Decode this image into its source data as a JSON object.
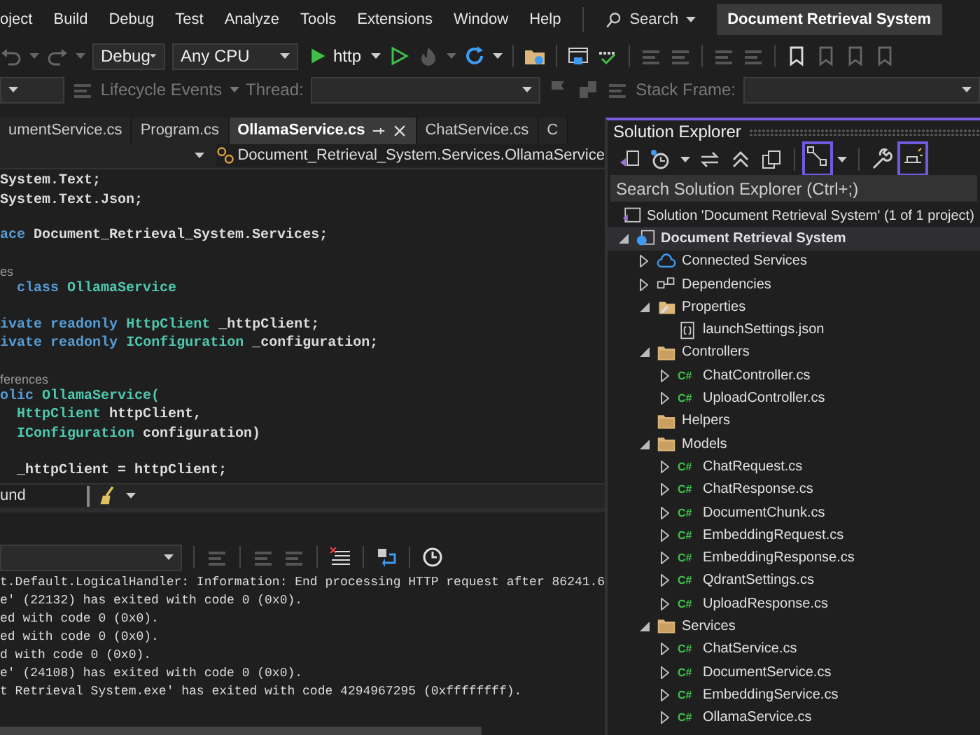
{
  "menu": [
    "oject",
    "Build",
    "Debug",
    "Test",
    "Analyze",
    "Tools",
    "Extensions",
    "Window",
    "Help"
  ],
  "search": {
    "label": "Search"
  },
  "solution_title": "Document Retrieval System",
  "toolbar": {
    "configuration": "Debug",
    "platform": "Any CPU",
    "run_target": "http"
  },
  "debug_location": {
    "lifecycle_events": "Lifecycle Events",
    "thread_label": "Thread:",
    "stack_frame_label": "Stack Frame:"
  },
  "editor": {
    "tabs": [
      {
        "label": "umentService.cs",
        "selected": false
      },
      {
        "label": "Program.cs",
        "selected": false
      },
      {
        "label": "OllamaService.cs",
        "selected": true
      },
      {
        "label": "ChatService.cs",
        "selected": false
      },
      {
        "label": "C",
        "selected": false
      }
    ],
    "navigation": "Document_Retrieval_System.Services.OllamaService",
    "lines": [
      {
        "kind": "code",
        "indent": false,
        "tokens": [
          {
            "text": "System.Text;",
            "kind": "plain"
          }
        ]
      },
      {
        "kind": "code",
        "indent": false,
        "tokens": [
          {
            "text": "System.Text.Json;",
            "kind": "plain"
          }
        ]
      },
      {
        "kind": "blank"
      },
      {
        "kind": "code",
        "indent": false,
        "tokens": [
          {
            "text": "ace",
            "kind": "keyword"
          },
          {
            "text": "Document_Retrieval_System.Services;",
            "kind": "plain"
          }
        ]
      },
      {
        "kind": "blank"
      },
      {
        "kind": "codelens",
        "indent": false,
        "tokens": [
          {
            "text": "es",
            "kind": "codelens"
          }
        ]
      },
      {
        "kind": "code",
        "indent": true,
        "tokens": [
          {
            "text": "class",
            "kind": "keyword"
          },
          {
            "text": "OllamaService",
            "kind": "type"
          }
        ]
      },
      {
        "kind": "blank"
      },
      {
        "kind": "code",
        "indent": false,
        "tokens": [
          {
            "text": "ivate",
            "kind": "keyword"
          },
          {
            "text": "readonly",
            "kind": "keyword"
          },
          {
            "text": "HttpClient",
            "kind": "type"
          },
          {
            "text": "_httpClient;",
            "kind": "plain"
          }
        ]
      },
      {
        "kind": "code",
        "indent": false,
        "tokens": [
          {
            "text": "ivate",
            "kind": "keyword"
          },
          {
            "text": "readonly",
            "kind": "keyword"
          },
          {
            "text": "IConfiguration",
            "kind": "type"
          },
          {
            "text": "_configuration;",
            "kind": "plain"
          }
        ]
      },
      {
        "kind": "blank"
      },
      {
        "kind": "codelens",
        "indent": false,
        "tokens": [
          {
            "text": "ferences",
            "kind": "codelens"
          }
        ]
      },
      {
        "kind": "code",
        "indent": false,
        "tokens": [
          {
            "text": "olic",
            "kind": "keyword"
          },
          {
            "text": "OllamaService(",
            "kind": "type"
          }
        ]
      },
      {
        "kind": "code",
        "indent": true,
        "tokens": [
          {
            "text": "HttpClient",
            "kind": "type"
          },
          {
            "text": "httpClient,",
            "kind": "plain"
          }
        ]
      },
      {
        "kind": "code",
        "indent": true,
        "tokens": [
          {
            "text": "IConfiguration",
            "kind": "type"
          },
          {
            "text": "configuration)",
            "kind": "plain"
          }
        ]
      },
      {
        "kind": "blank"
      },
      {
        "kind": "code",
        "indent": true,
        "tokens": [
          {
            "text": "_httpClient = httpClient;",
            "kind": "plain"
          }
        ]
      }
    ],
    "find": "und"
  },
  "output": {
    "lines": [
      "t.Default.LogicalHandler: Information: End processing HTTP request after 86241.6",
      "e' (22132) has exited with code 0 (0x0).",
      "ed with code 0 (0x0).",
      "ed with code 0 (0x0).",
      "d with code 0 (0x0).",
      "e' (24108) has exited with code 0 (0x0).",
      "t Retrieval System.exe' has exited with code 4294967295 (0xffffffff)."
    ]
  },
  "solution_explorer": {
    "title": "Solution Explorer",
    "search": {
      "placeholder": "Search Solution Explorer (Ctrl+;)"
    },
    "tree": [
      {
        "label": "Solution 'Document Retrieval System' (1 of 1 project)",
        "kind": "solution",
        "selected": false,
        "children": [
          {
            "label": "Document Retrieval System",
            "kind": "project",
            "selected": true,
            "expanded": true,
            "children": [
              {
                "label": "Connected Services",
                "kind": "connected",
                "selected": false,
                "expanded": false
              },
              {
                "label": "Dependencies",
                "kind": "dependencies",
                "selected": false,
                "expanded": false
              },
              {
                "label": "Properties",
                "kind": "properties",
                "selected": false,
                "expanded": true,
                "children": [
                  {
                    "label": "launchSettings.json",
                    "kind": "json",
                    "selected": false
                  }
                ]
              },
              {
                "label": "Controllers",
                "kind": "folder",
                "selected": false,
                "expanded": true,
                "children": [
                  {
                    "label": "ChatController.cs",
                    "kind": "csharp",
                    "icon_text": "C#",
                    "selected": false,
                    "expanded": false
                  },
                  {
                    "label": "UploadController.cs",
                    "kind": "csharp",
                    "icon_text": "C#",
                    "selected": false,
                    "expanded": false
                  }
                ]
              },
              {
                "label": "Helpers",
                "kind": "folder",
                "selected": false
              },
              {
                "label": "Models",
                "kind": "folder",
                "selected": false,
                "expanded": true,
                "children": [
                  {
                    "label": "ChatRequest.cs",
                    "kind": "csharp",
                    "icon_text": "C#",
                    "selected": false,
                    "expanded": false
                  },
                  {
                    "label": "ChatResponse.cs",
                    "kind": "csharp",
                    "icon_text": "C#",
                    "selected": false,
                    "expanded": false
                  },
                  {
                    "label": "DocumentChunk.cs",
                    "kind": "csharp",
                    "icon_text": "C#",
                    "selected": false,
                    "expanded": false
                  },
                  {
                    "label": "EmbeddingRequest.cs",
                    "kind": "csharp",
                    "icon_text": "C#",
                    "selected": false,
                    "expanded": false
                  },
                  {
                    "label": "EmbeddingResponse.cs",
                    "kind": "csharp",
                    "icon_text": "C#",
                    "selected": false,
                    "expanded": false
                  },
                  {
                    "label": "QdrantSettings.cs",
                    "kind": "csharp",
                    "icon_text": "C#",
                    "selected": false,
                    "expanded": false
                  },
                  {
                    "label": "UploadResponse.cs",
                    "kind": "csharp",
                    "icon_text": "C#",
                    "selected": false,
                    "expanded": false
                  }
                ]
              },
              {
                "label": "Services",
                "kind": "folder",
                "selected": false,
                "expanded": true,
                "children": [
                  {
                    "label": "ChatService.cs",
                    "kind": "csharp",
                    "icon_text": "C#",
                    "selected": false,
                    "expanded": false
                  },
                  {
                    "label": "DocumentService.cs",
                    "kind": "csharp",
                    "icon_text": "C#",
                    "selected": false,
                    "expanded": false
                  },
                  {
                    "label": "EmbeddingService.cs",
                    "kind": "csharp",
                    "icon_text": "C#",
                    "selected": false,
                    "expanded": false
                  },
                  {
                    "label": "OllamaService.cs",
                    "kind": "csharp",
                    "icon_text": "C#",
                    "selected": false,
                    "expanded": false
                  }
                ]
              }
            ]
          }
        ]
      }
    ]
  }
}
